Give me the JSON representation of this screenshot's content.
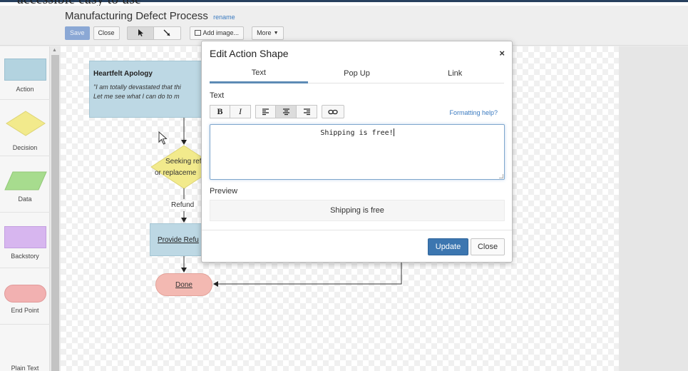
{
  "slide": {
    "partial_text": "accessible easy to use"
  },
  "header": {
    "title": "Manufacturing Defect Process",
    "rename": "rename"
  },
  "toolbar": {
    "save": "Save",
    "close": "Close",
    "add_image": "Add image...",
    "more": "More"
  },
  "palette": {
    "items": [
      {
        "label": "Action",
        "color": "#b3d3e0"
      },
      {
        "label": "Decision",
        "color": "#f2ea8c"
      },
      {
        "label": "Data",
        "color": "#a7dc8e"
      },
      {
        "label": "Backstory",
        "color": "#d7b6ef"
      },
      {
        "label": "End Point",
        "color": "#f2b1b1"
      },
      {
        "label": "Plain Text"
      }
    ]
  },
  "canvas": {
    "apology": {
      "title": "Heartfelt Apology",
      "line1": "\"I am totally devastated that thi",
      "line2": "Let me see what I can do to m"
    },
    "decision_line1": "Seeking refu",
    "decision_line2": "or replaceme",
    "edge_refund": "Refund",
    "provide_refund": "Provide Refu",
    "done": "Done"
  },
  "modal": {
    "title": "Edit Action Shape",
    "tabs": [
      "Text",
      "Pop Up",
      "Link"
    ],
    "active_tab": "Text",
    "text_label": "Text",
    "formatting_help": "Formatting help?",
    "text_value": "Shipping is free!",
    "preview_label": "Preview",
    "preview_value": "Shipping is free",
    "update": "Update",
    "close": "Close"
  },
  "colors": {
    "accent": "#3c76b0",
    "tab_underline": "#5d8bb5",
    "link": "#3a7ac0"
  }
}
